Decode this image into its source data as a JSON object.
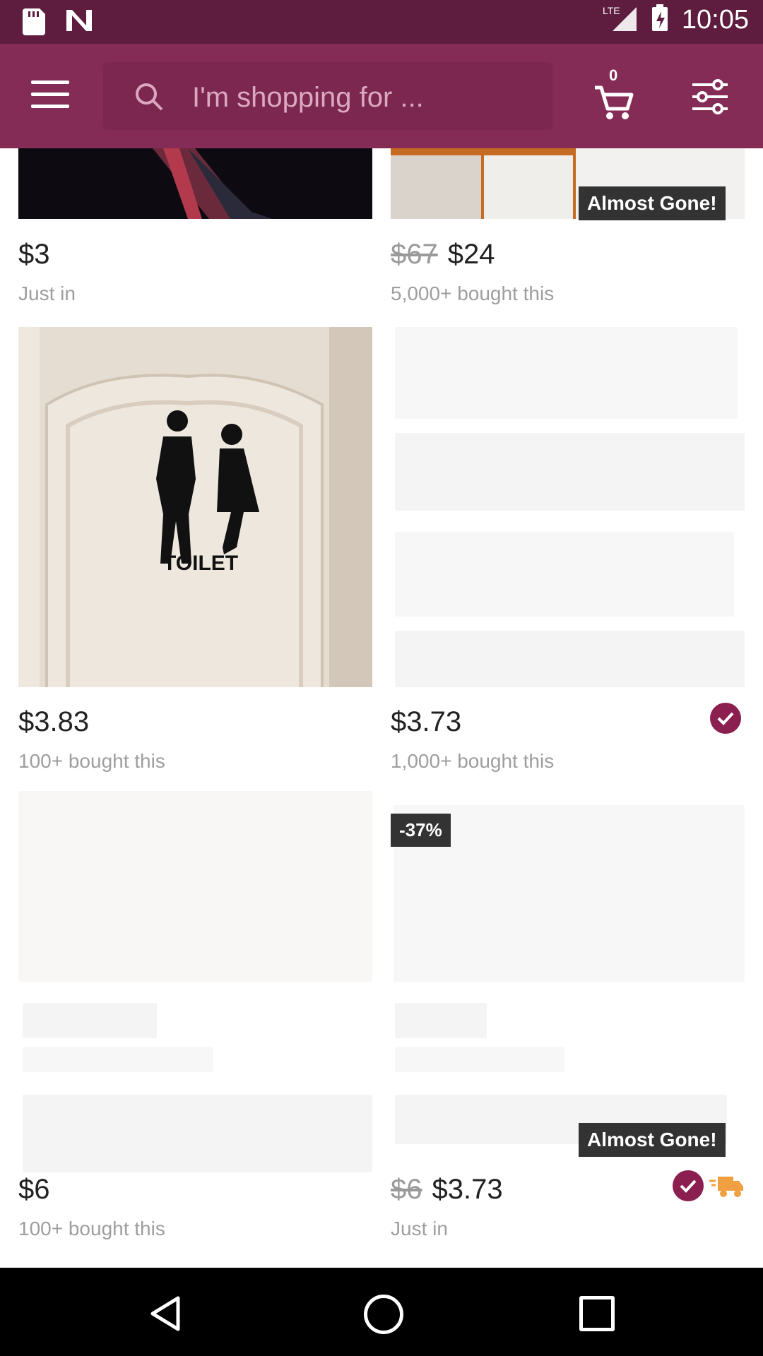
{
  "status_bar": {
    "time": "10:05",
    "network": "LTE"
  },
  "app_bar": {
    "search_placeholder": "I'm shopping for ...",
    "cart_count": "0",
    "brand_color": "#842b56"
  },
  "products": [
    {
      "price": "$3",
      "old_price": "",
      "subtitle": "Just in"
    },
    {
      "price": "$24",
      "old_price": "$67",
      "subtitle": "5,000+ bought this",
      "badge": "Almost Gone!"
    },
    {
      "price": "$3.83",
      "old_price": "",
      "subtitle": "100+ bought this",
      "image_text": "TOILET"
    },
    {
      "price": "$3.73",
      "old_price": "",
      "subtitle": "1,000+ bought this",
      "verified": true
    },
    {
      "price": "$6",
      "old_price": "",
      "subtitle": "100+ bought this"
    },
    {
      "price": "$3.73",
      "old_price": "$6",
      "subtitle": "Just in",
      "discount": "-37%",
      "badge": "Almost Gone!",
      "verified": true,
      "fast_shipping": true
    }
  ]
}
